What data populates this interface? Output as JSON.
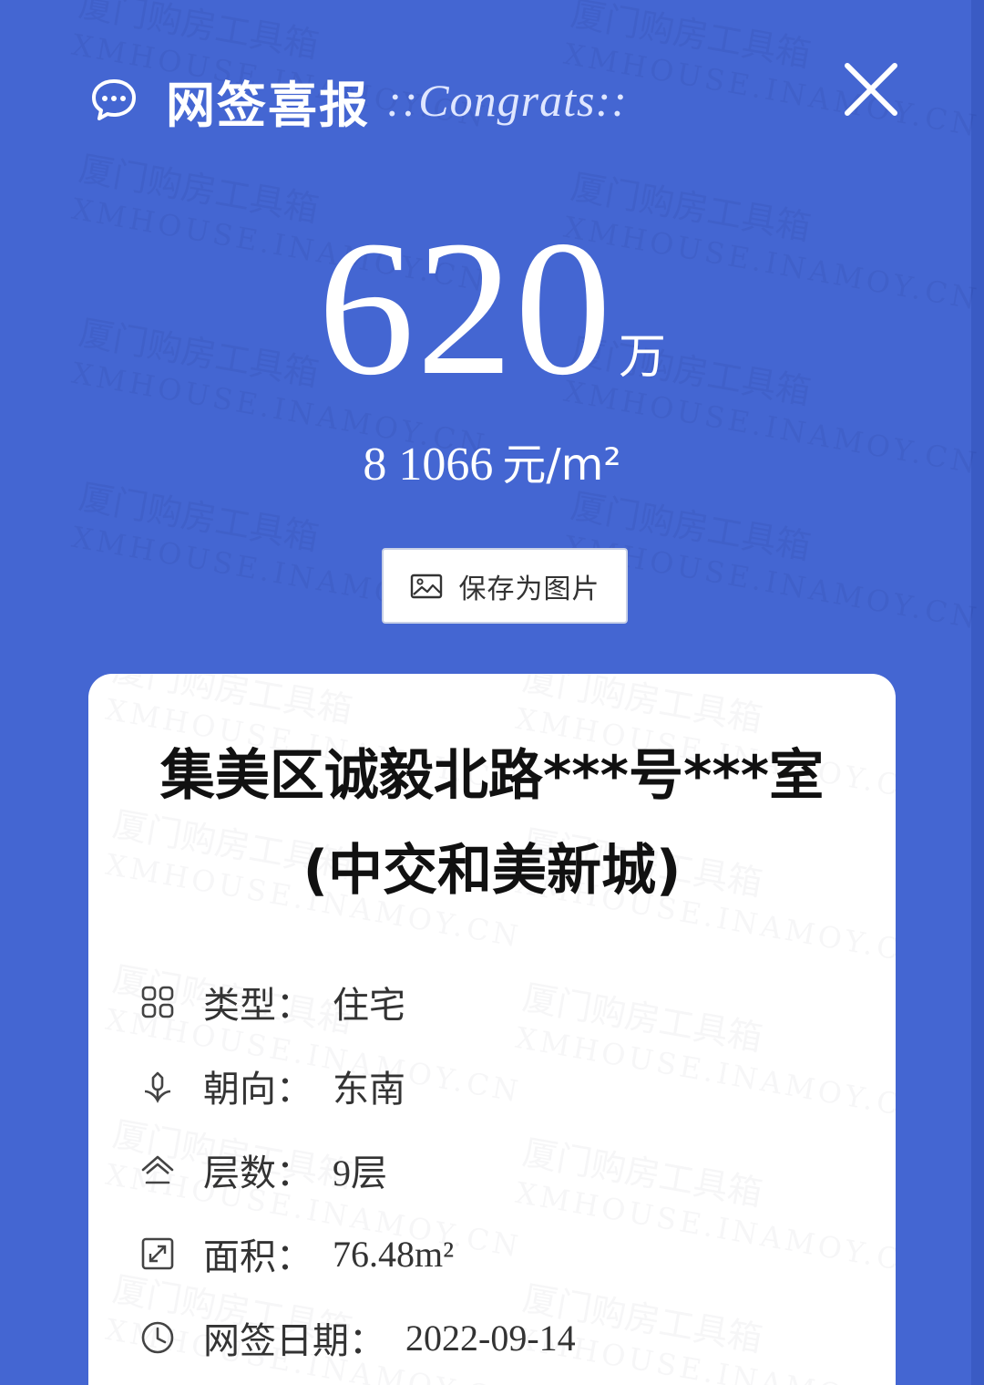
{
  "header": {
    "title": "网签喜报",
    "subtitle": "::Congrats::"
  },
  "price": {
    "total": "620",
    "total_unit": "万",
    "unit_price": "8 1066",
    "unit_price_unit": "元/m²"
  },
  "save_button": {
    "label": "保存为图片"
  },
  "card": {
    "address": "集美区诚毅北路***号***室(中交和美新城)",
    "info": [
      {
        "icon": "grid-icon",
        "label": "类型：",
        "value": "住宅"
      },
      {
        "icon": "flower-icon",
        "label": "朝向：",
        "value": "东南"
      },
      {
        "icon": "house-icon",
        "label": "层数：",
        "value": "9层"
      },
      {
        "icon": "expand-icon",
        "label": "面积：",
        "value": "76.48m²"
      },
      {
        "icon": "clock-icon",
        "label": "网签日期：",
        "value": "2022-09-14"
      }
    ]
  }
}
